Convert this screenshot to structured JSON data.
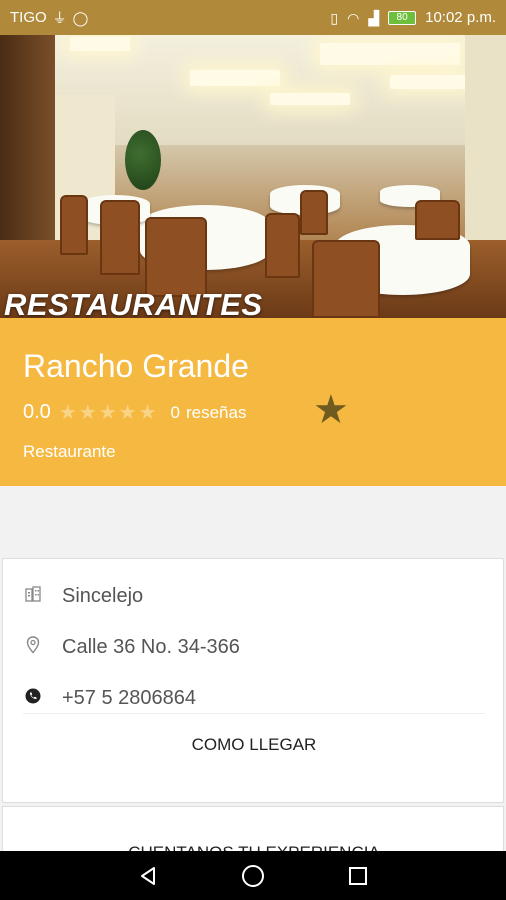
{
  "status_bar": {
    "carrier": "TIGO",
    "battery": "80",
    "time": "10:02 p.m."
  },
  "hero": {
    "title": "RESTAURANTES"
  },
  "place": {
    "name": "Rancho Grande",
    "rating": "0.0",
    "review_count": "0",
    "review_label": "reseñas",
    "category": "Restaurante"
  },
  "details": {
    "city": "Sincelejo",
    "address": "Calle 36 No. 34-366",
    "phone": "+57 5 2806864",
    "directions_label": "COMO LLEGAR"
  },
  "experience": {
    "label": "CUENTANOS TU EXPERIENCIA"
  },
  "colors": {
    "status_bar": "#b08a3a",
    "accent_yellow": "#f5b942",
    "favorite_star": "#6f5a20"
  },
  "icons": {
    "city": "building-icon",
    "address": "location-pin-icon",
    "phone": "phone-icon",
    "favorite": "star-icon"
  }
}
